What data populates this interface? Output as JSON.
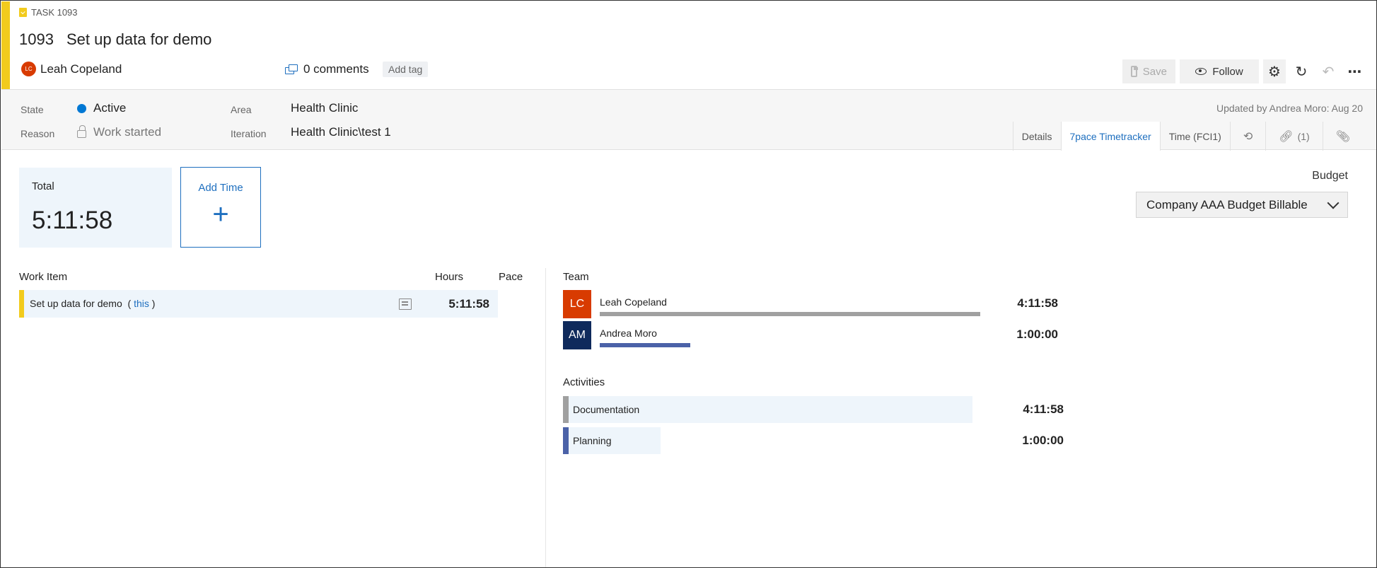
{
  "header": {
    "task_type": "TASK 1093",
    "id": "1093",
    "title": "Set up data for demo",
    "owner_initials": "LC",
    "owner_name": "Leah Copeland",
    "comments": "0 comments",
    "add_tag": "Add tag",
    "accent_color": "#f2cb1d"
  },
  "toolbar": {
    "save": "Save",
    "follow": "Follow",
    "settings_icon": "gear-icon",
    "refresh_icon": "refresh-icon",
    "undo_icon": "undo-icon",
    "more_icon": "more-icon"
  },
  "fields": {
    "state_label": "State",
    "state_value": "Active",
    "state_color": "#0078d4",
    "reason_label": "Reason",
    "reason_value": "Work started",
    "area_label": "Area",
    "area_value": "Health Clinic",
    "iteration_label": "Iteration",
    "iteration_value": "Health Clinic\\test 1",
    "updated": "Updated by Andrea Moro: Aug 20"
  },
  "tabs": [
    {
      "label": "Details"
    },
    {
      "label": "7pace Timetracker",
      "active": true
    },
    {
      "label": "Time (FCI1)"
    },
    {
      "icon": "history-icon"
    },
    {
      "label": "(1)",
      "icon": "link-icon"
    },
    {
      "icon": "attachment-icon"
    }
  ],
  "total": {
    "label": "Total",
    "value": "5:11:58"
  },
  "add_time": {
    "label": "Add Time",
    "icon": "plus-icon"
  },
  "budget": {
    "label": "Budget",
    "selected": "Company AAA Budget Billable"
  },
  "work_items": {
    "headers": {
      "item": "Work Item",
      "hours": "Hours",
      "pace": "Pace"
    },
    "rows": [
      {
        "name": "Set up data for demo",
        "link": "this",
        "hours": "5:11:58"
      }
    ]
  },
  "team": {
    "heading": "Team",
    "members": [
      {
        "initials": "LC",
        "name": "Leah Copeland",
        "time": "4:11:58",
        "share": 1.0,
        "color": "#d83b01",
        "bar_color": "#a0a0a0"
      },
      {
        "initials": "AM",
        "name": "Andrea Moro",
        "time": "1:00:00",
        "share": 0.238,
        "color": "#0f2a5c",
        "bar_color": "#4b62a8"
      }
    ]
  },
  "activities": {
    "heading": "Activities",
    "items": [
      {
        "name": "Documentation",
        "time": "4:11:58",
        "share": 1.0,
        "color": "#a0a0a0"
      },
      {
        "name": "Planning",
        "time": "1:00:00",
        "share": 0.238,
        "color": "#4b62a8"
      }
    ]
  }
}
